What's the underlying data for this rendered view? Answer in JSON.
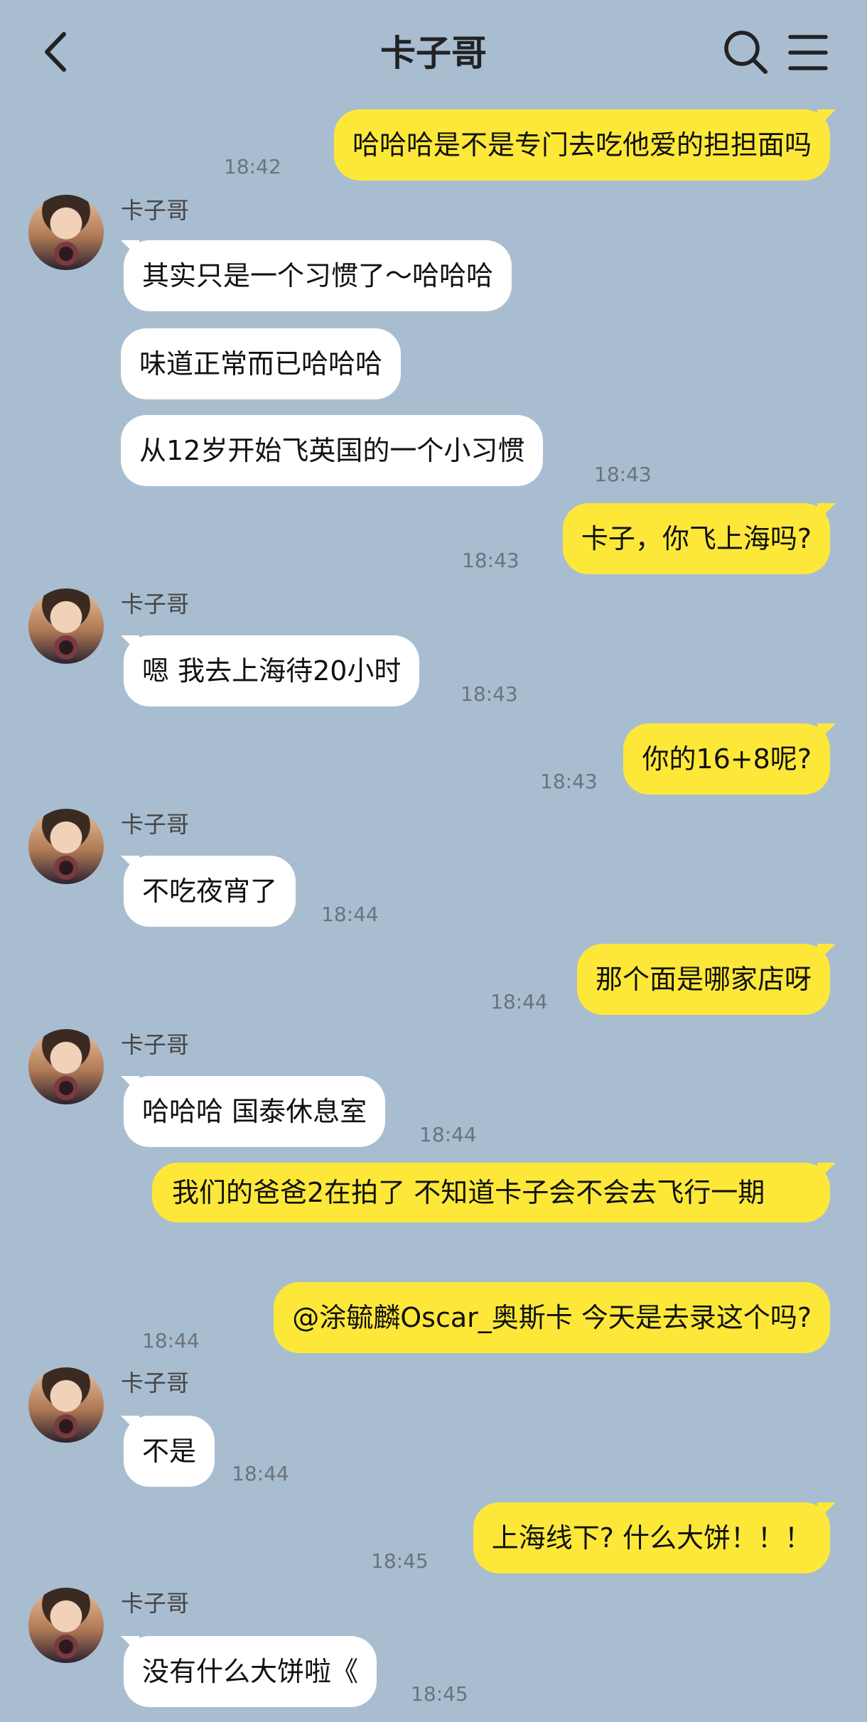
{
  "header": {
    "title": "卡子哥",
    "back_icon": "chevron-left-icon",
    "search_icon": "search-icon",
    "menu_icon": "menu-icon"
  },
  "colors": {
    "background": "#a9bdd1",
    "mine_bubble": "#fde83a",
    "theirs_bubble": "#ffffff"
  },
  "messages": [
    {
      "from": "me",
      "text": "哈哈哈是不是专门去吃他爱的担担面吗",
      "time": "18:42"
    },
    {
      "from": "卡子哥",
      "text": "其实只是一个习惯了～哈哈哈"
    },
    {
      "from": "卡子哥",
      "text": "味道正常而已哈哈哈"
    },
    {
      "from": "卡子哥",
      "text": "从12岁开始飞英国的一个小习惯",
      "time": "18:43"
    },
    {
      "from": "me",
      "text": "卡子，你飞上海吗?",
      "time": "18:43"
    },
    {
      "from": "卡子哥",
      "text": "嗯 我去上海待20小时",
      "time": "18:43"
    },
    {
      "from": "me",
      "text": "你的16+8呢?",
      "time": "18:43"
    },
    {
      "from": "卡子哥",
      "text": "不吃夜宵了",
      "time": "18:44"
    },
    {
      "from": "me",
      "text": "那个面是哪家店呀",
      "time": "18:44"
    },
    {
      "from": "卡子哥",
      "text": "哈哈哈 国泰休息室",
      "time": "18:44"
    },
    {
      "from": "me",
      "text": "我们的爸爸2在拍了 不知道卡子会不会去飞行一期"
    },
    {
      "from": "me",
      "text": "@涂毓麟Oscar_奥斯卡  今天是去录这个吗?",
      "time": "18:44"
    },
    {
      "from": "卡子哥",
      "text": "不是",
      "time": "18:44"
    },
    {
      "from": "me",
      "text": "上海线下? 什么大饼！！！",
      "time": "18:45"
    },
    {
      "from": "卡子哥",
      "text": "没有什么大饼啦《",
      "time": "18:45"
    }
  ]
}
